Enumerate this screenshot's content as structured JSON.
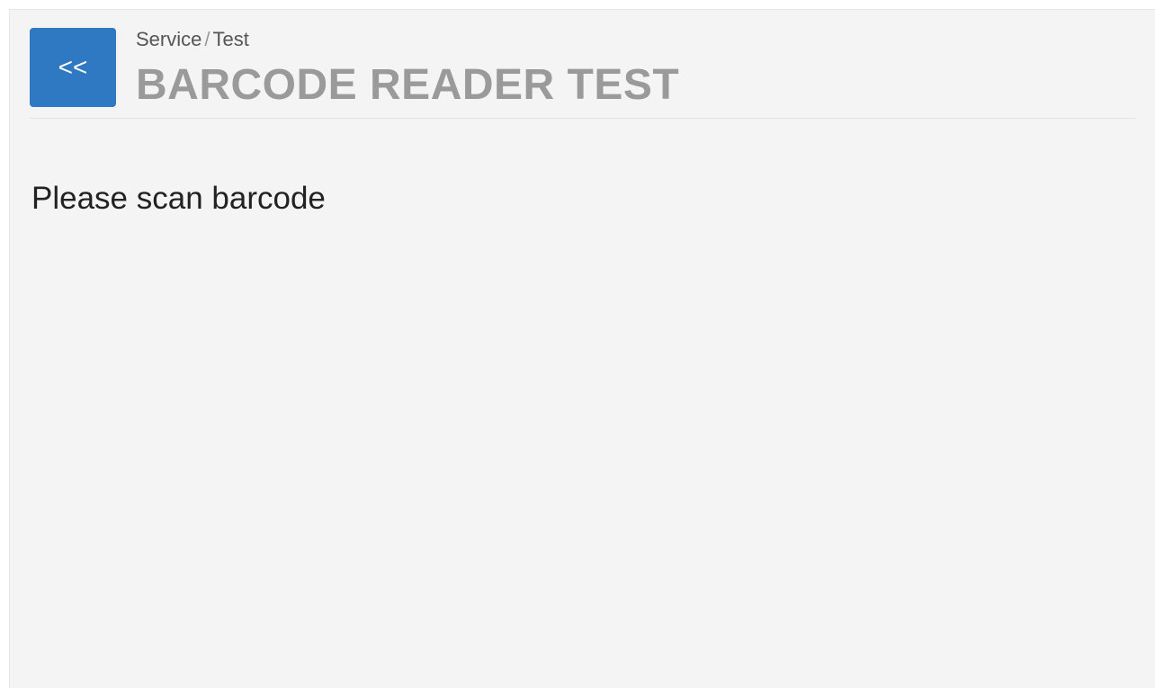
{
  "header": {
    "back_label": "<<",
    "breadcrumb": {
      "parent": "Service",
      "separator": "/",
      "current": "Test"
    },
    "title": "BARCODE READER TEST"
  },
  "main": {
    "prompt": "Please scan barcode"
  },
  "colors": {
    "accent": "#2f78c2",
    "background": "#f4f4f4",
    "title": "#9a9a9a"
  }
}
